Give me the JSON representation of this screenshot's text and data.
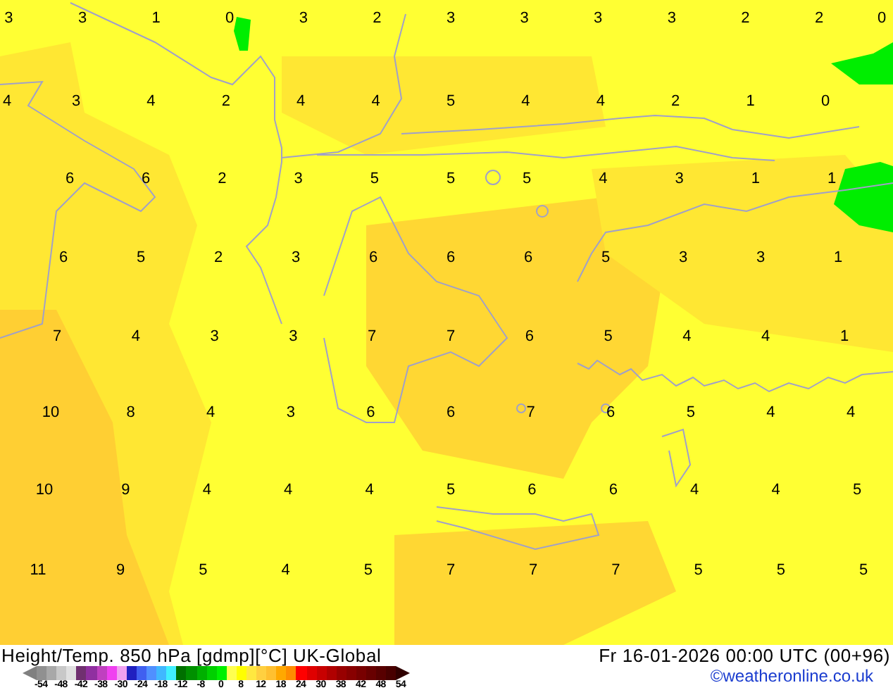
{
  "map": {
    "rows": [
      [
        "3",
        "3",
        "1",
        "0",
        "3",
        "2",
        "3",
        "3",
        "3",
        "3",
        "2",
        "2",
        "0"
      ],
      [
        "4",
        "3",
        "4",
        "2",
        "4",
        "4",
        "5",
        "4",
        "4",
        "2",
        "1",
        "0"
      ],
      [
        "6",
        "6",
        "2",
        "3",
        "5",
        "5",
        "5",
        "4",
        "3",
        "1",
        "1"
      ],
      [
        "6",
        "5",
        "2",
        "3",
        "6",
        "6",
        "6",
        "5",
        "3",
        "3",
        "1"
      ],
      [
        "7",
        "4",
        "3",
        "3",
        "7",
        "7",
        "6",
        "5",
        "4",
        "4",
        "1"
      ],
      [
        "10",
        "8",
        "4",
        "3",
        "6",
        "6",
        "7",
        "6",
        "5",
        "4",
        "4"
      ],
      [
        "10",
        "9",
        "4",
        "4",
        "4",
        "5",
        "6",
        "6",
        "4",
        "4",
        "5"
      ],
      [
        "11",
        "9",
        "5",
        "4",
        "5",
        "7",
        "7",
        "7",
        "5",
        "5",
        "5"
      ]
    ]
  },
  "footer": {
    "title": "Height/Temp. 850 hPa [gdmp][°C] UK-Global",
    "datetime": "Fr 16-01-2026 00:00 UTC (00+96)",
    "credit": "©weatheronline.co.uk",
    "legend": {
      "swatches": [
        {
          "color": "#909090"
        },
        {
          "color": "#a8a8a8"
        },
        {
          "color": "#c8c8c8"
        },
        {
          "color": "#e0e0e0"
        },
        {
          "color": "#703070"
        },
        {
          "color": "#9030a0"
        },
        {
          "color": "#c040c0"
        },
        {
          "color": "#f040f0"
        },
        {
          "color": "#f0a0f0"
        },
        {
          "color": "#2020c0"
        },
        {
          "color": "#4060f0"
        },
        {
          "color": "#5090ff"
        },
        {
          "color": "#40b8ff"
        },
        {
          "color": "#40f0ff"
        },
        {
          "color": "#007000"
        },
        {
          "color": "#009000"
        },
        {
          "color": "#00b000"
        },
        {
          "color": "#00d000"
        },
        {
          "color": "#00f000"
        },
        {
          "color": "#ffff50"
        },
        {
          "color": "#ffff00"
        },
        {
          "color": "#ffe840"
        },
        {
          "color": "#ffd040"
        },
        {
          "color": "#ffc030"
        },
        {
          "color": "#ffa800"
        },
        {
          "color": "#ff8c00"
        },
        {
          "color": "#ff0000"
        },
        {
          "color": "#e00000"
        },
        {
          "color": "#c80000"
        },
        {
          "color": "#b00000"
        },
        {
          "color": "#980000"
        },
        {
          "color": "#880000"
        },
        {
          "color": "#780000"
        },
        {
          "color": "#680000"
        },
        {
          "color": "#580000"
        },
        {
          "color": "#480000"
        }
      ],
      "ticks": [
        "-54",
        "-48",
        "-42",
        "-38",
        "-30",
        "-24",
        "-18",
        "-12",
        "-8",
        "0",
        "8",
        "12",
        "18",
        "24",
        "30",
        "38",
        "42",
        "48",
        "54"
      ]
    }
  }
}
